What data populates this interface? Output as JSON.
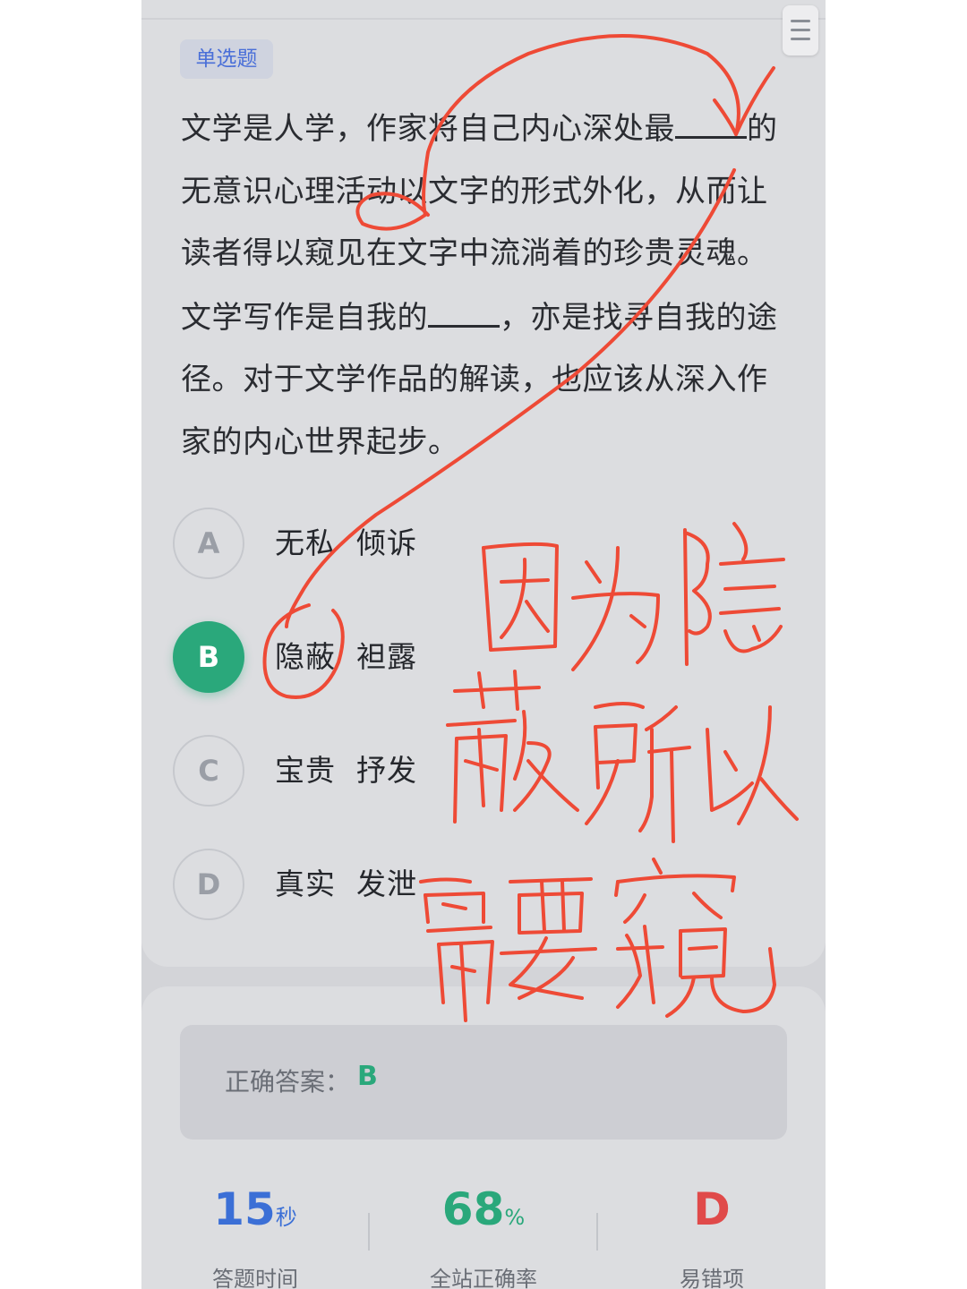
{
  "question": {
    "type_label": "单选题",
    "stem_parts": [
      "文学是人学，作家将自己内心深处最",
      "的无意识心理活动以文字的形式外化，从而让读者得以窥见在文字中流淌着的珍贵灵魂。文学写作是自我的",
      "，亦是找寻自我的途径。对于文学作品的解读，也应该从深入作家的内心世界起步。"
    ],
    "options": [
      {
        "letter": "A",
        "text": "无私  倾诉",
        "selected": false
      },
      {
        "letter": "B",
        "text": "隐蔽  袒露",
        "selected": true
      },
      {
        "letter": "C",
        "text": "宝贵  抒发",
        "selected": false
      },
      {
        "letter": "D",
        "text": "真实  发泄",
        "selected": false
      }
    ]
  },
  "answer": {
    "label": "正确答案：",
    "value": "B"
  },
  "stats": [
    {
      "value": "15",
      "unit": "秒",
      "label": "答题时间",
      "color": "#3b6fd6"
    },
    {
      "value": "68",
      "unit": "%",
      "label": "全站正确率",
      "color": "#2aa87b"
    },
    {
      "value": "D",
      "unit": "",
      "label": "易错项",
      "color": "#e04a4a"
    }
  ],
  "annotation": {
    "handwritten_note": "因为隐蔽所以需要窥",
    "ink_color": "#ee4a36"
  },
  "colors": {
    "accent_green": "#2aa87b",
    "badge_blue": "#4a6fd8",
    "page_background": "#d3d4d8"
  }
}
